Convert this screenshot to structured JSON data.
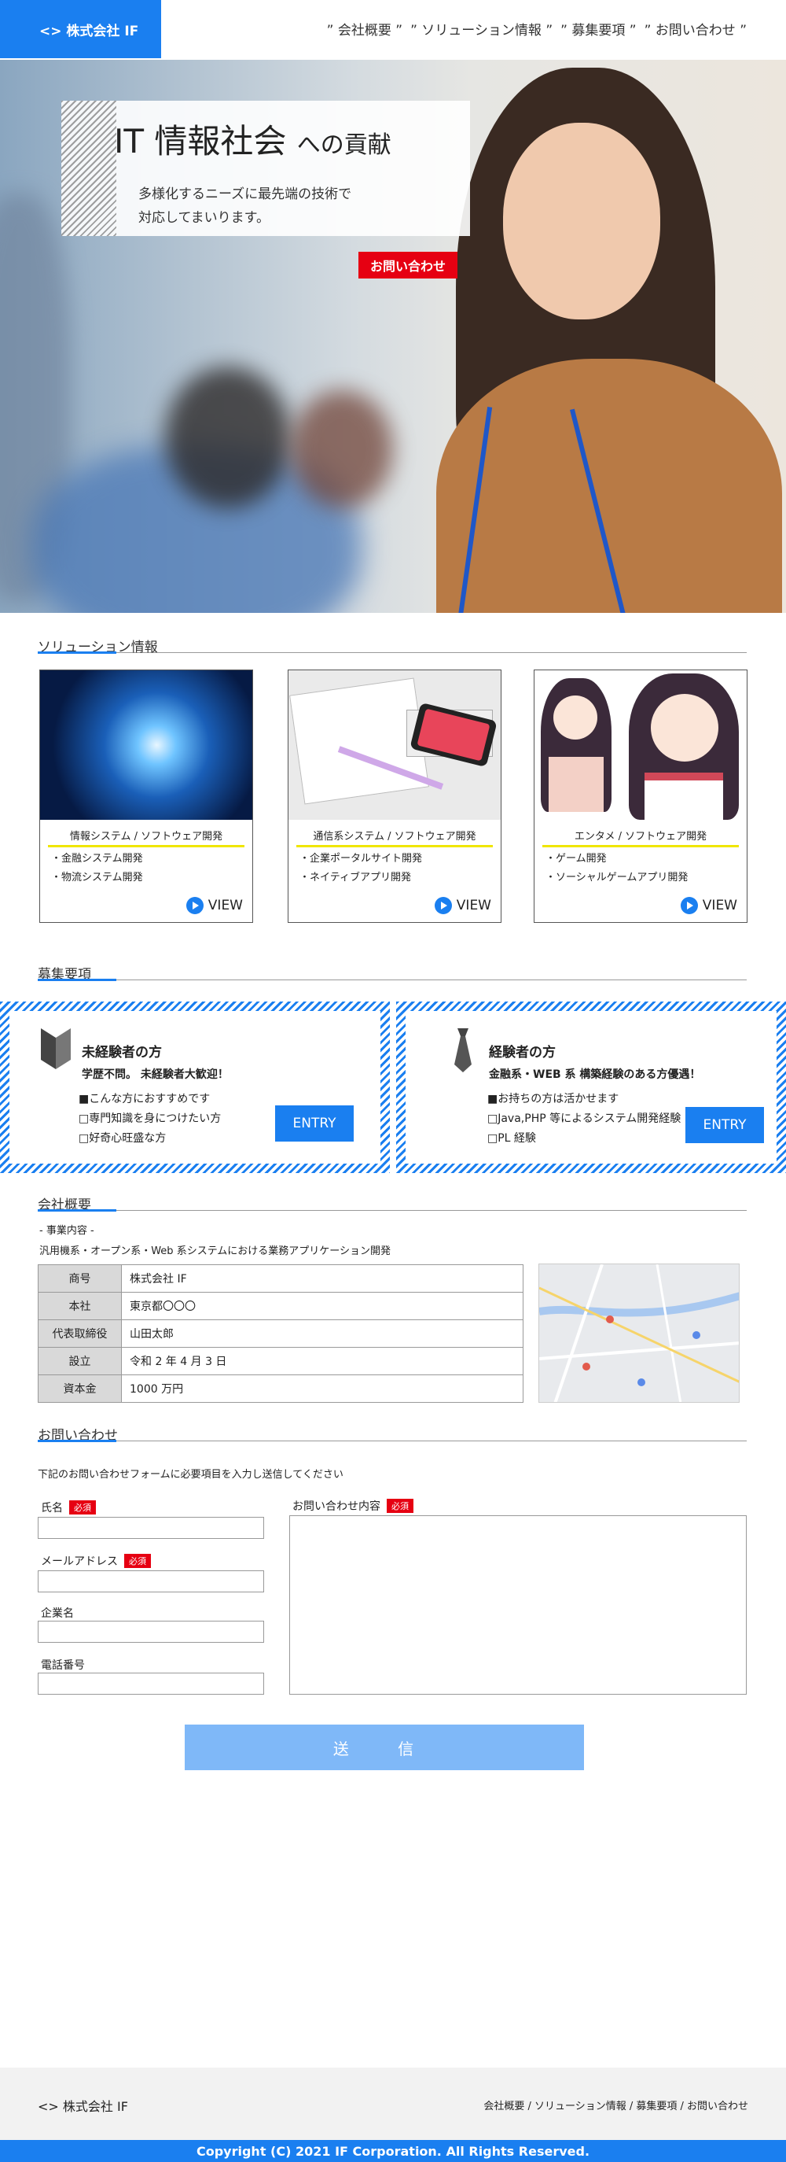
{
  "header": {
    "logo": "<> 株式会社 IF",
    "nav": [
      "” 会社概要 ”",
      "” ソリューション情報 ”",
      "” 募集要項 ”",
      "” お問い合わせ ”"
    ]
  },
  "hero": {
    "title_main": "IT 情報社会",
    "title_tail": "への貢献",
    "subtitle": "多様化するニーズに最先端の技術で\n対応してまいります。",
    "button": "お問い合わせ"
  },
  "solutions": {
    "heading": "ソリューション情報",
    "view_label": "VIEW",
    "cards": [
      {
        "title": "情報システム / ソフトウェア開発",
        "items": [
          "・金融システム開発",
          "・物流システム開発"
        ]
      },
      {
        "title": "通信系システム / ソフトウェア開発",
        "items": [
          "・企業ポータルサイト開発",
          "・ネイティブアプリ開発"
        ]
      },
      {
        "title": "エンタメ / ソフトウェア開発",
        "items": [
          "・ゲーム開発",
          "・ソーシャルゲームアプリ開発"
        ]
      }
    ]
  },
  "recruit": {
    "heading": "募集要項",
    "entry_label": "ENTRY",
    "inexperienced": {
      "title": "未経験者の方",
      "subtitle": "学歴不問。 未経験者大歓迎！",
      "list": "■こんな方におすすめです\n□専門知識を身につけたい方\n□好奇心旺盛な方"
    },
    "experienced": {
      "title": "経験者の方",
      "subtitle": "金融系・WEB 系 構築経験のある方優遇！",
      "list": "■お持ちの方は活かせます\n□Java,PHP 等によるシステム開発経験\n□PL 経験"
    }
  },
  "company": {
    "heading": "会社概要",
    "business_label": "- 事業内容 -",
    "business_text": "汎用機系・オープン系・Web 系システムにおける業務アプリケーション開発",
    "rows": [
      {
        "key": "商号",
        "value": "株式会社 IF"
      },
      {
        "key": "本社",
        "value": "東京都〇〇〇"
      },
      {
        "key": "代表取締役",
        "value": "山田太郎"
      },
      {
        "key": "設立",
        "value": "令和 2 年 4 月 3 日"
      },
      {
        "key": "資本金",
        "value": "1000 万円"
      }
    ]
  },
  "contact": {
    "heading": "お問い合わせ",
    "intro": "下記のお問い合わせフォームに必要項目を入力し送信してください",
    "required": "必須",
    "name_label": "氏名",
    "mail_label": "メールアドレス",
    "company_label": "企業名",
    "phone_label": "電話番号",
    "message_label": "お問い合わせ内容",
    "submit": "送 信"
  },
  "footer": {
    "logo": "<> 株式会社 IF",
    "links": "会社概要 / ソリューション情報 / 募集要項 / お問い合わせ",
    "copyright": "Copyright (C) 2021 IF Corporation. All Rights Reserved."
  },
  "colors": {
    "accent": "#1a7ff0",
    "required": "#e60012",
    "highlight": "#f0e600"
  }
}
